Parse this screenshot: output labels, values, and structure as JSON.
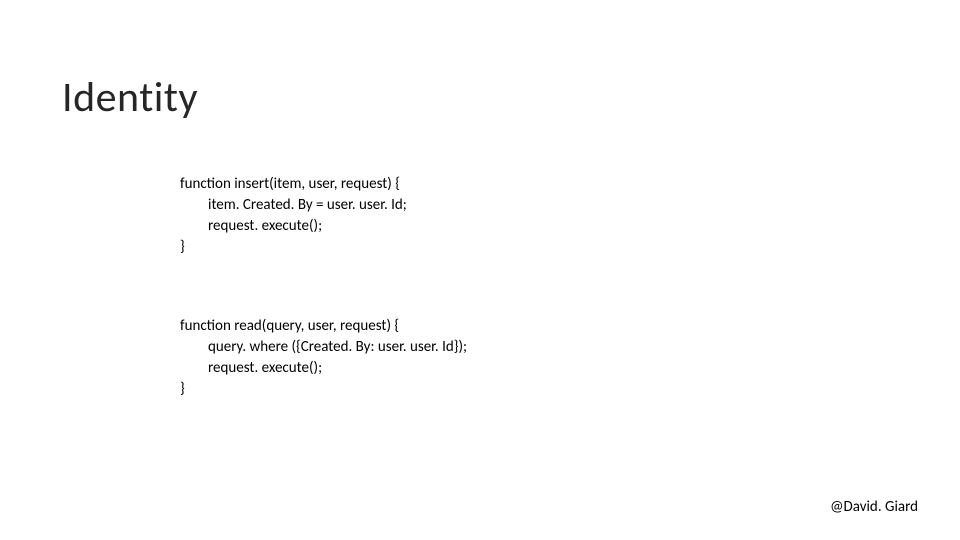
{
  "title": "Identity",
  "code_block_1": {
    "line1": "function insert(item, user, request) {",
    "line2": "item. Created. By = user. user. Id;",
    "line3": "request. execute();",
    "line4": "}"
  },
  "code_block_2": {
    "line1": "function read(query, user, request) {",
    "line2": "query. where ({Created. By: user. user. Id});",
    "line3": "request. execute();",
    "line4": "}"
  },
  "footer": "@David. Giard"
}
